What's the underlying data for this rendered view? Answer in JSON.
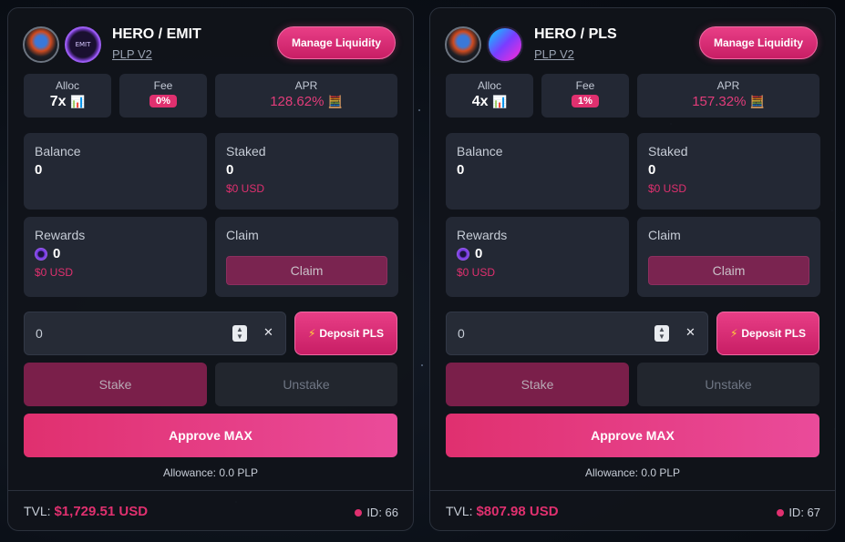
{
  "colors": {
    "accent": "#e0306f",
    "panel": "#232834",
    "card": "#11141a"
  },
  "pools": [
    {
      "pair": "HERO / EMIT",
      "version": "PLP V2",
      "manage_label": "Manage Liquidity",
      "token_logos": [
        "hero-token-icon",
        "emit-token-icon"
      ],
      "emit_logo_text": "EMIT",
      "alloc_label": "Alloc",
      "alloc": "7x",
      "fee_label": "Fee",
      "fee": "0%",
      "apr_label": "APR",
      "apr": "128.62%",
      "balance_label": "Balance",
      "balance": "0",
      "staked_label": "Staked",
      "staked": "0",
      "staked_usd": "$0 USD",
      "rewards_label": "Rewards",
      "rewards": "0",
      "rewards_usd": "$0 USD",
      "claim_label": "Claim",
      "claim_button": "Claim",
      "amount_value": "0",
      "deposit_label": "Deposit PLS",
      "stake_label": "Stake",
      "unstake_label": "Unstake",
      "approve_label": "Approve MAX",
      "allowance": "Allowance: 0.0 PLP",
      "tvl_label": "TVL:",
      "tvl": "$1,729.51 USD",
      "id": "ID: 66"
    },
    {
      "pair": "HERO / PLS",
      "version": "PLP V2",
      "manage_label": "Manage Liquidity",
      "token_logos": [
        "hero-token-icon",
        "pls-token-icon"
      ],
      "alloc_label": "Alloc",
      "alloc": "4x",
      "fee_label": "Fee",
      "fee": "1%",
      "apr_label": "APR",
      "apr": "157.32%",
      "balance_label": "Balance",
      "balance": "0",
      "staked_label": "Staked",
      "staked": "0",
      "staked_usd": "$0 USD",
      "rewards_label": "Rewards",
      "rewards": "0",
      "rewards_usd": "$0 USD",
      "claim_label": "Claim",
      "claim_button": "Claim",
      "amount_value": "0",
      "deposit_label": "Deposit PLS",
      "stake_label": "Stake",
      "unstake_label": "Unstake",
      "approve_label": "Approve MAX",
      "allowance": "Allowance: 0.0 PLP",
      "tvl_label": "TVL:",
      "tvl": "$807.98 USD",
      "id": "ID: 67"
    }
  ]
}
